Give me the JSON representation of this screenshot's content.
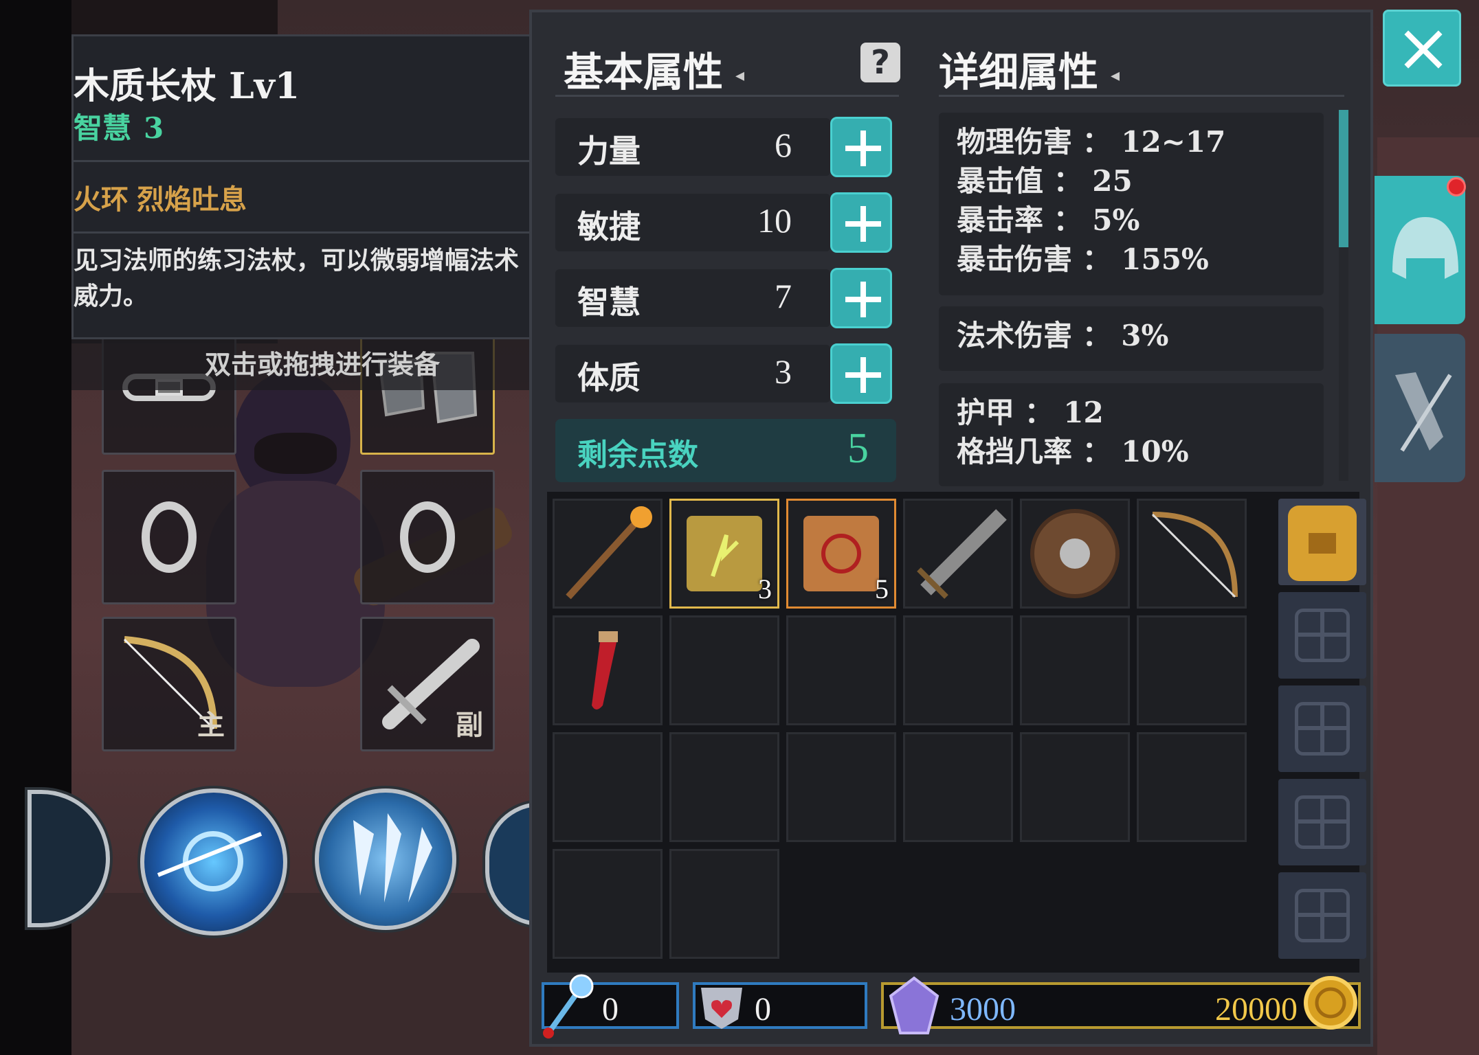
{
  "tooltip": {
    "title": "木质长杖 Lv1",
    "attr_name": "智慧",
    "attr_value": "3",
    "skill_slot": "火环",
    "skill_name": "烈焰吐息",
    "description": "见习法师的练习法杖，可以微弱增幅法术威力。"
  },
  "hint": "双击或拖拽进行装备",
  "equip_tags": {
    "main": "主",
    "off": "副"
  },
  "basic": {
    "title": "基本属性",
    "stats": [
      {
        "label": "力量",
        "value": "6"
      },
      {
        "label": "敏捷",
        "value": "10"
      },
      {
        "label": "智慧",
        "value": "7"
      },
      {
        "label": "体质",
        "value": "3"
      }
    ],
    "remaining_label": "剩余点数",
    "remaining_value": "5"
  },
  "detail": {
    "title": "详细属性",
    "group1": [
      "物理伤害 ： 12~17",
      "暴击值 ： 25",
      "暴击率 ： 5%",
      "暴击伤害 ： 155%"
    ],
    "group2": [
      "法术伤害 ： 3%"
    ],
    "group3": [
      "护甲 ： 12",
      "格挡几率 ： 10%"
    ]
  },
  "help_icon": "?",
  "inventory": {
    "counts": {
      "scroll_green": "3",
      "scroll_red": "5"
    }
  },
  "currency": {
    "staff_gems": "0",
    "hearts": "0",
    "crystals": "3000",
    "gold": "20000"
  },
  "colors": {
    "accent": "#36b7b8",
    "gold": "#e2b94c",
    "panel": "#2b2d33"
  }
}
